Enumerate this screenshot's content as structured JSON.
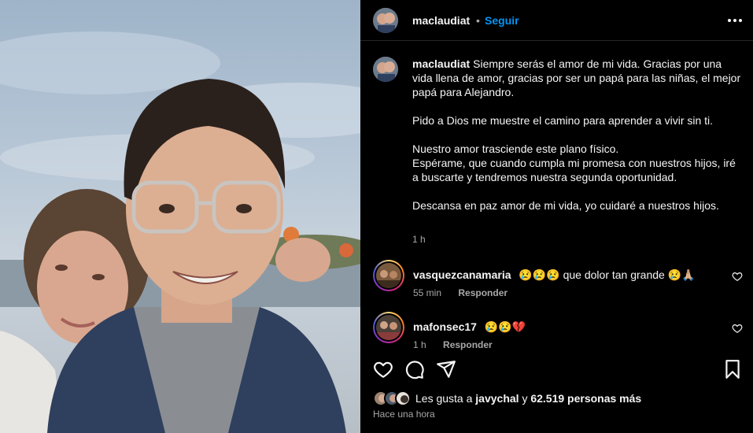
{
  "header": {
    "username": "maclaudiat",
    "separator": "•",
    "follow_label": "Seguir"
  },
  "caption": {
    "username": "maclaudiat",
    "paragraphs": [
      "Siempre serás el amor de mi vida. Gracias por una vida llena de amor, gracias por ser un papá para las niñas, el mejor papá para Alejandro.",
      "Pido a Dios me muestre el camino para aprender a vivir sin ti.",
      "Nuestro amor trasciende este plano físico.",
      "Espérame, que cuando cumpla mi promesa con nuestros hijos, iré a buscarte y tendremos nuestra segunda oportunidad.",
      "Descansa en paz amor de mi vida, yo cuidaré a nuestros hijos."
    ],
    "time": "1 h"
  },
  "comments": [
    {
      "username": "vasquezcanamaria",
      "text": "😢😢😢 que dolor tan grande 😢🙏🏼",
      "time": "55 min",
      "reply_label": "Responder"
    },
    {
      "username": "mafonsec17",
      "text": "😢😢💔",
      "time": "1 h",
      "reply_label": "Responder"
    }
  ],
  "actions": {
    "like_icon": "heart-icon",
    "comment_icon": "comment-icon",
    "share_icon": "paper-plane-icon",
    "save_icon": "bookmark-icon"
  },
  "likes": {
    "prefix": "Les gusta a",
    "user": "javychal",
    "middle": "y",
    "count": "62.519 personas más"
  },
  "post_time": "Hace una hora",
  "colors": {
    "accent": "#0095f6",
    "background": "#000000",
    "text": "#f5f5f5",
    "secondary_text": "#a8a8a8"
  }
}
